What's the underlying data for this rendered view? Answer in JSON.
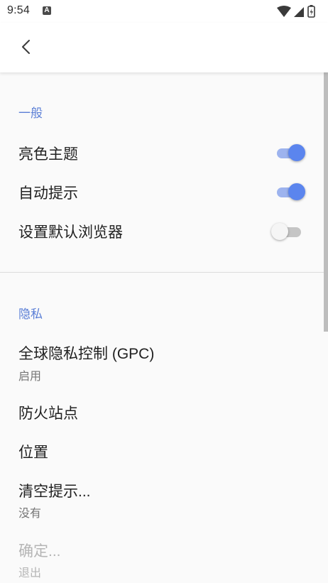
{
  "status_bar": {
    "time": "9:54",
    "notification_letter": "A",
    "icons": [
      "wifi-icon",
      "signal-icon",
      "battery-charging-icon"
    ]
  },
  "app_bar": {
    "back_icon": "chevron-left-icon"
  },
  "sections": {
    "general": {
      "title": "一般",
      "items": [
        {
          "label": "亮色主题",
          "toggle": true
        },
        {
          "label": "自动提示",
          "toggle": true
        },
        {
          "label": "设置默认浏览器",
          "toggle": false
        }
      ]
    },
    "privacy": {
      "title": "隐私",
      "items": [
        {
          "label": "全球隐私控制 (GPC)",
          "summary": "启用"
        },
        {
          "label": "防火站点"
        },
        {
          "label": "位置"
        },
        {
          "label": "清空提示...",
          "summary": "没有"
        },
        {
          "label": "确定...",
          "summary": "退出",
          "disabled": true
        }
      ]
    }
  },
  "colors": {
    "accent": "#5b85ee",
    "section_title": "#5b7fd6",
    "switch_track_on": "#9db3ee"
  }
}
